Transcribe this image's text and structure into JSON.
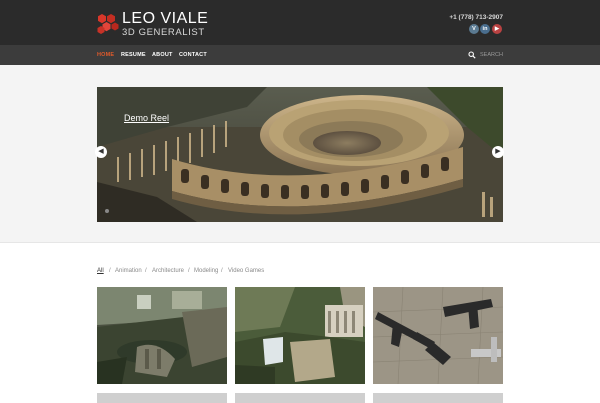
{
  "brand": {
    "name": "LEO VIALE",
    "tagline": "3D GENERALIST"
  },
  "contact": {
    "phone": "+1 (778) 713-2907",
    "social": [
      {
        "icon": "vimeo-icon",
        "label": "V"
      },
      {
        "icon": "linkedin-icon",
        "label": "in"
      },
      {
        "icon": "youtube-icon",
        "label": "▶"
      }
    ]
  },
  "nav": {
    "items": [
      {
        "label": "HOME",
        "active": true
      },
      {
        "label": "RESUME",
        "active": false
      },
      {
        "label": "ABOUT",
        "active": false
      },
      {
        "label": "CONTACT",
        "active": false
      }
    ],
    "search_placeholder": "SEARCH"
  },
  "hero": {
    "caption": "Demo Reel",
    "prev_icon": "arrow-left-icon",
    "next_icon": "arrow-right-icon"
  },
  "filter": {
    "items": [
      "All",
      "Animation",
      "Architecture",
      "Modeling",
      "Video Games"
    ],
    "active": "All",
    "separator": "/"
  },
  "colors": {
    "header_bg": "#2b2b2b",
    "nav_bg": "#3c3c3c",
    "accent": "#e05a2b",
    "logo": "#d9372a"
  }
}
